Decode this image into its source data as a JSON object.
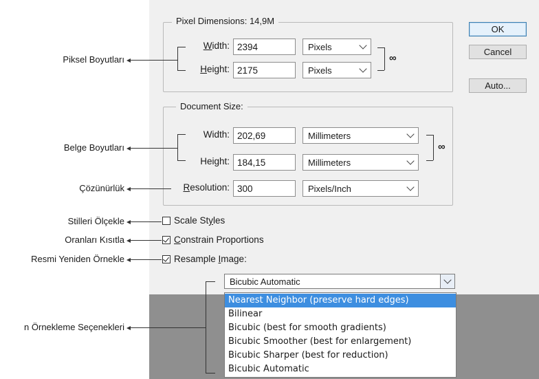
{
  "pixel_dimensions": {
    "title": "Pixel Dimensions:",
    "size": "14,9M",
    "width_label": "Width:",
    "width_value": "2394",
    "width_unit": "Pixels",
    "height_label": "Height:",
    "height_value": "2175",
    "height_unit": "Pixels"
  },
  "document_size": {
    "title": "Document Size:",
    "width_label": "Width:",
    "width_value": "202,69",
    "width_unit": "Millimeters",
    "height_label": "Height:",
    "height_value": "184,15",
    "height_unit": "Millimeters",
    "resolution_label": "Resolution:",
    "resolution_value": "300",
    "resolution_unit": "Pixels/Inch"
  },
  "buttons": {
    "ok": "OK",
    "cancel": "Cancel",
    "auto": "Auto..."
  },
  "options": {
    "scale_styles": "Scale Styles",
    "constrain": "Constrain Proportions",
    "resample": "Resample Image:"
  },
  "resample_select": {
    "value": "Bicubic Automatic",
    "items": [
      "Nearest Neighbor (preserve hard edges)",
      "Bilinear",
      "Bicubic (best for smooth gradients)",
      "Bicubic Smoother (best for enlargement)",
      "Bicubic Sharper (best for reduction)",
      "Bicubic Automatic"
    ]
  },
  "annotations": {
    "pixel": "Piksel Boyutları",
    "document": "Belge Boyutları",
    "resolution": "Çözünürlük",
    "scale": "Stilleri Ölçekle",
    "constrain": "Oranları Kısıtla",
    "resample": "Resmi Yeniden Örnekle",
    "resample_options": "n Örnekleme Seçenekleri"
  },
  "icons": {
    "link": "chain-link-icon",
    "check": "checkmark-icon",
    "dropdown": "chevron-down-icon"
  }
}
